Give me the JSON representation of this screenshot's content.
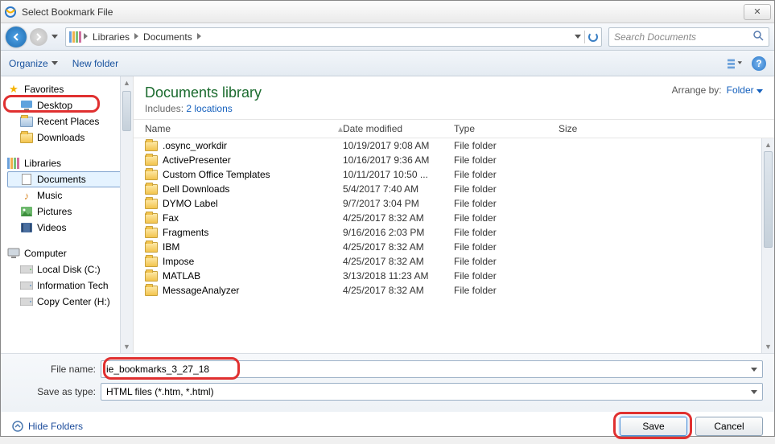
{
  "window": {
    "title": "Select Bookmark File"
  },
  "breadcrumb": {
    "seg1": "Libraries",
    "seg2": "Documents"
  },
  "search": {
    "placeholder": "Search Documents"
  },
  "toolbar": {
    "organize": "Organize",
    "newfolder": "New folder"
  },
  "sidebar": {
    "favorites": "Favorites",
    "desktop": "Desktop",
    "recent": "Recent Places",
    "downloads": "Downloads",
    "libraries": "Libraries",
    "documents": "Documents",
    "music": "Music",
    "pictures": "Pictures",
    "videos": "Videos",
    "computer": "Computer",
    "localdisk": "Local Disk (C:)",
    "infotech": "Information Tech",
    "copycenter": "Copy Center (H:)"
  },
  "library": {
    "title": "Documents library",
    "includes_label": "Includes:",
    "includes_link": "2 locations",
    "arrange_label": "Arrange by:",
    "arrange_value": "Folder"
  },
  "columns": {
    "name": "Name",
    "date": "Date modified",
    "type": "Type",
    "size": "Size"
  },
  "files": [
    {
      "name": ".osync_workdir",
      "date": "10/19/2017 9:08 AM",
      "type": "File folder"
    },
    {
      "name": "ActivePresenter",
      "date": "10/16/2017 9:36 AM",
      "type": "File folder"
    },
    {
      "name": "Custom Office Templates",
      "date": "10/11/2017 10:50 ...",
      "type": "File folder"
    },
    {
      "name": "Dell Downloads",
      "date": "5/4/2017 7:40 AM",
      "type": "File folder"
    },
    {
      "name": "DYMO Label",
      "date": "9/7/2017 3:04 PM",
      "type": "File folder"
    },
    {
      "name": "Fax",
      "date": "4/25/2017 8:32 AM",
      "type": "File folder"
    },
    {
      "name": "Fragments",
      "date": "9/16/2016 2:03 PM",
      "type": "File folder"
    },
    {
      "name": "IBM",
      "date": "4/25/2017 8:32 AM",
      "type": "File folder"
    },
    {
      "name": "Impose",
      "date": "4/25/2017 8:32 AM",
      "type": "File folder"
    },
    {
      "name": "MATLAB",
      "date": "3/13/2018 11:23 AM",
      "type": "File folder"
    },
    {
      "name": "MessageAnalyzer",
      "date": "4/25/2017 8:32 AM",
      "type": "File folder"
    }
  ],
  "form": {
    "filename_label": "File name:",
    "filename_value": "ie_bookmarks_3_27_18",
    "saveas_label": "Save as type:",
    "saveas_value": "HTML files (*.htm, *.html)"
  },
  "footer": {
    "hide": "Hide Folders",
    "save": "Save",
    "cancel": "Cancel"
  }
}
